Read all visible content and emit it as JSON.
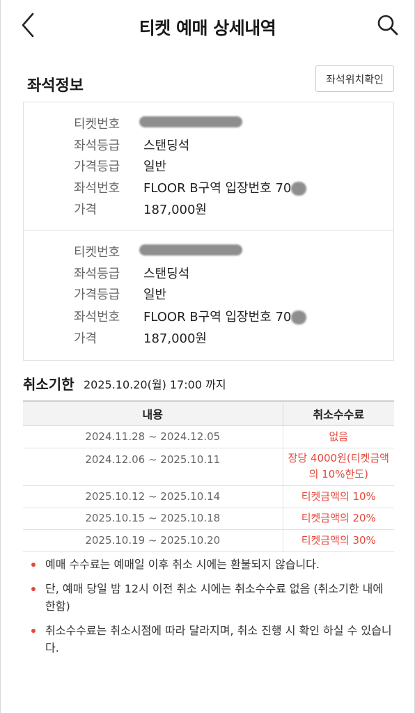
{
  "header": {
    "title": "티켓 예매 상세내역",
    "back_icon": "chevron-left-icon",
    "search_icon": "search-icon"
  },
  "seat_info": {
    "title": "좌석정보",
    "location_button": "좌석위치확인",
    "labels": {
      "ticket_no": "티켓번호",
      "seat_grade": "좌석등급",
      "price_grade": "가격등급",
      "seat_no": "좌석번호",
      "price": "가격"
    },
    "tickets": [
      {
        "ticket_no": "",
        "seat_grade": "스탠딩석",
        "price_grade": "일반",
        "seat_no": "FLOOR B구역 입장번호 70",
        "price": "187,000원"
      },
      {
        "ticket_no": "",
        "seat_grade": "스탠딩석",
        "price_grade": "일반",
        "seat_no": "FLOOR B구역 입장번호 70",
        "price": "187,000원"
      }
    ]
  },
  "cancel": {
    "title": "취소기한",
    "deadline": "2025.10.20(월) 17:00 까지",
    "table": {
      "headers": [
        "내용",
        "취소수수료"
      ],
      "rows": [
        {
          "period": "2024.11.28 ~ 2024.12.05",
          "fee": "없음"
        },
        {
          "period": "2024.12.06 ~ 2025.10.11",
          "fee_line1": "장당 4000원(티켓금액",
          "fee_line2": "의 10%한도)"
        },
        {
          "period": "2025.10.12 ~ 2025.10.14",
          "fee": "티켓금액의 10%"
        },
        {
          "period": "2025.10.15 ~ 2025.10.18",
          "fee": "티켓금액의 20%"
        },
        {
          "period": "2025.10.19 ~ 2025.10.20",
          "fee": "티켓금액의 30%"
        }
      ]
    }
  },
  "notes": [
    "예매 수수료는 예매일 이후 취소 시에는 환불되지 않습니다.",
    "단, 예매 당일 밤 12시 이전 취소 시에는 취소수수료 없음 (취소기한 내에 한함)",
    "취소수수료는 취소시점에 따라 달라지며, 취소 진행 시 확인 하실 수 있습니다."
  ],
  "colors": {
    "accent": "#e5483b",
    "label": "#666666",
    "border": "#e0e0e0"
  }
}
